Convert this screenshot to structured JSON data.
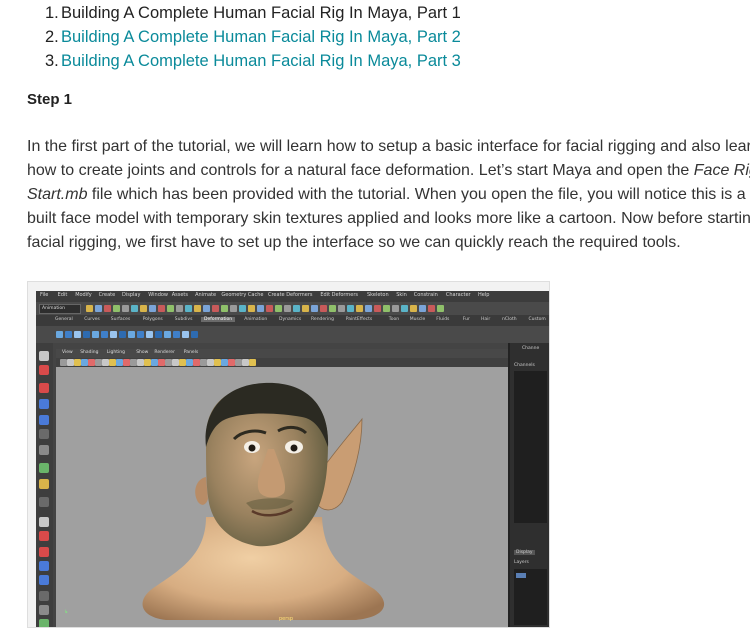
{
  "toc": [
    {
      "num": "1.",
      "text": "Building A Complete Human Facial Rig In Maya, Part 1",
      "link": false
    },
    {
      "num": "2.",
      "text": "Building A Complete Human Facial Rig In Maya, Part 2",
      "link": true
    },
    {
      "num": "3.",
      "text": "Building A Complete Human Facial Rig In Maya, Part 3",
      "link": true
    }
  ],
  "step_heading": "Step 1",
  "intro": {
    "line1": "In the first part of the tutorial, we will learn how to setup a basic interface for facial rigging and also learn",
    "line2_before": "how to create joints and controls for a natural face deformation. Let’s start Maya and open the ",
    "line2_em": "Face Rig",
    "line3_em": "Start.mb",
    "line3_after": " file which has been provided with the tutorial. When you open the file, you will notice this is a pre-",
    "line4": "built face model with temporary skin textures applied and looks more like a cartoon. Now before starting",
    "line5": "facial rigging, we first have to set up the interface so we can quickly reach the required tools."
  },
  "maya": {
    "menus": [
      "File",
      "Edit",
      "Modify",
      "Create",
      "Display",
      "Window",
      "Assets",
      "Animate",
      "Geometry Cache",
      "Create Deformers",
      "Edit Deformers",
      "Skeleton",
      "Skin",
      "Constrain",
      "Character",
      "Help"
    ],
    "mode": "Animation",
    "shelf_tabs": [
      "General",
      "Curves",
      "Surfaces",
      "Polygons",
      "Subdivs",
      "Deformation",
      "Animation",
      "Dynamics",
      "Rendering",
      "PaintEffects",
      "Toon",
      "Muscle",
      "Fluids",
      "Fur",
      "Hair",
      "nCloth",
      "Custom"
    ],
    "active_shelf": "Deformation",
    "viewport_menus": [
      "View",
      "Shading",
      "Lighting",
      "Show",
      "Renderer",
      "Panels"
    ],
    "camera_label": "persp",
    "channel_box_label": "Channe",
    "channels_label": "Channels",
    "display_tab": "Display",
    "layers_label": "Layers",
    "colors": {
      "link": "#0a8a9a",
      "viewport": "#a0a0a0",
      "skin": "#d9b48a"
    }
  }
}
